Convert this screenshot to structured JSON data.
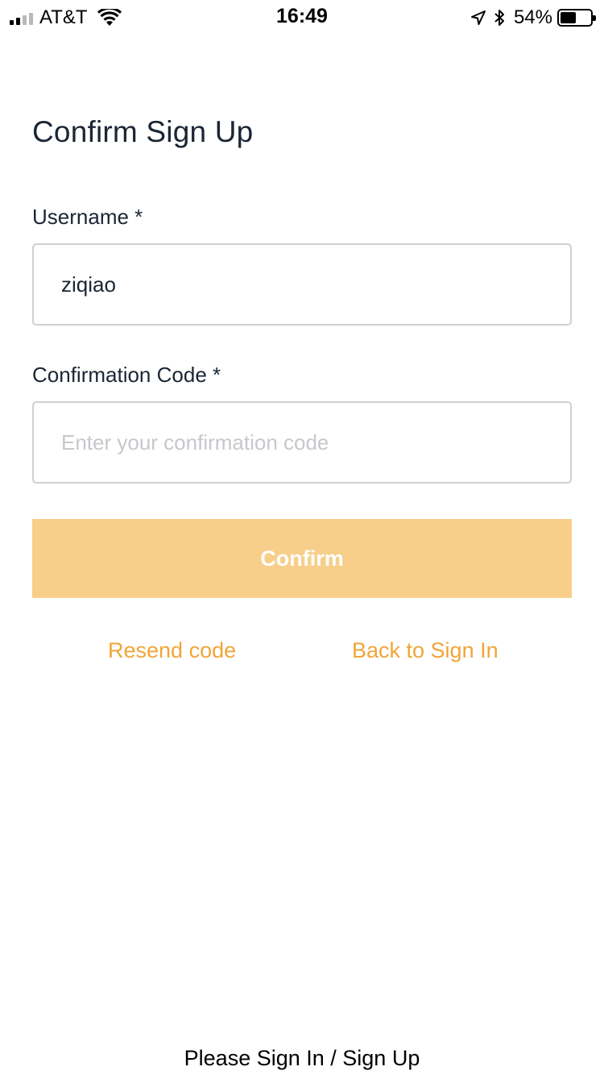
{
  "status_bar": {
    "carrier": "AT&T",
    "time": "16:49",
    "battery_percent": "54%",
    "battery_level": 0.54,
    "signal_bars_filled": 2,
    "icons": [
      "signal-icon",
      "wifi-icon",
      "location-arrow-icon",
      "bluetooth-icon",
      "battery-icon"
    ]
  },
  "form": {
    "title": "Confirm Sign Up",
    "username": {
      "label": "Username *",
      "value": "ziqiao",
      "placeholder": ""
    },
    "code": {
      "label": "Confirmation Code *",
      "value": "",
      "placeholder": "Enter your confirmation code"
    },
    "confirm_label": "Confirm",
    "resend_label": "Resend code",
    "back_label": "Back to Sign In"
  },
  "footer": {
    "text": "Please Sign In / Sign Up"
  },
  "colors": {
    "accent": "#f0a538",
    "button_disabled": "#f7cf8b",
    "text": "#1b2634",
    "border": "#d0d0d0"
  }
}
